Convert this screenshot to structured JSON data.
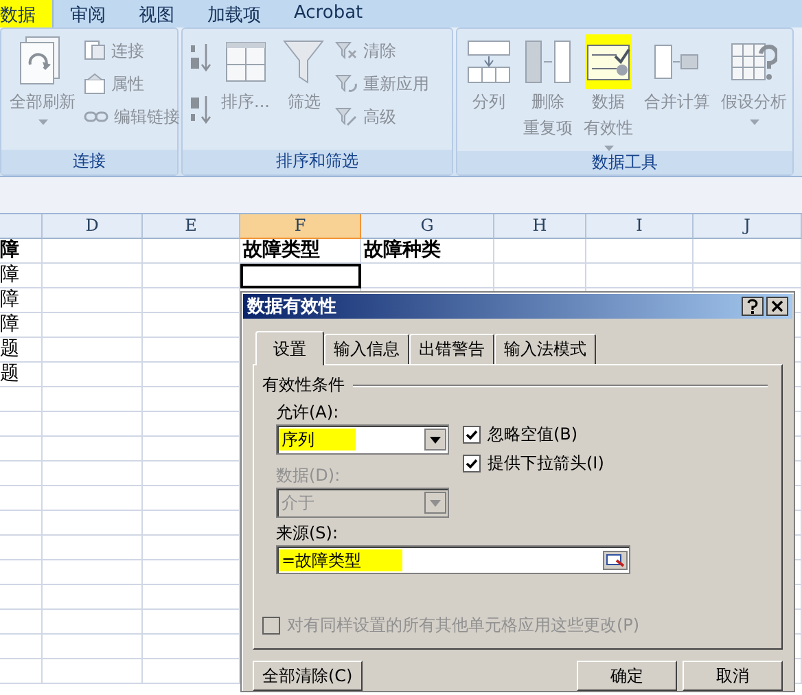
{
  "ribbon_tabs": [
    {
      "label": "数据",
      "selected": true,
      "highlighted": true
    },
    {
      "label": "审阅",
      "selected": false,
      "highlighted": false
    },
    {
      "label": "视图",
      "selected": false,
      "highlighted": false
    },
    {
      "label": "加载项",
      "selected": false,
      "highlighted": false
    },
    {
      "label": "Acrobat",
      "selected": false,
      "highlighted": false
    }
  ],
  "ribbon_groups": [
    {
      "title": "连接",
      "items": [
        {
          "kind": "large",
          "label": "全部刷新",
          "dropdown": true
        },
        {
          "kind": "small",
          "label": "连接"
        },
        {
          "kind": "small",
          "label": "属性"
        },
        {
          "kind": "small",
          "label": "编辑链接"
        }
      ]
    },
    {
      "title": "排序和筛选",
      "items": [
        {
          "kind": "icon"
        },
        {
          "kind": "icon"
        },
        {
          "kind": "large",
          "label": "排序..."
        },
        {
          "kind": "large",
          "label": "筛选"
        },
        {
          "kind": "small",
          "label": "清除"
        },
        {
          "kind": "small",
          "label": "重新应用"
        },
        {
          "kind": "small",
          "label": "高级"
        }
      ]
    },
    {
      "title": "数据工具",
      "items": [
        {
          "kind": "large",
          "label": "分列"
        },
        {
          "kind": "large",
          "label_lines": [
            "删除",
            "重复项"
          ]
        },
        {
          "kind": "large",
          "label_lines": [
            "数据",
            "有效性"
          ],
          "dropdown": true,
          "highlighted": true
        },
        {
          "kind": "large",
          "label": "合并计算"
        },
        {
          "kind": "large",
          "label": "假设分析",
          "dropdown": true
        }
      ]
    }
  ],
  "sheet": {
    "columns": [
      {
        "label": "D",
        "selected": false
      },
      {
        "label": "E",
        "selected": false
      },
      {
        "label": "F",
        "selected": true
      },
      {
        "label": "G",
        "selected": false
      },
      {
        "label": "H",
        "selected": false
      },
      {
        "label": "I",
        "selected": false
      },
      {
        "label": "J",
        "selected": false
      }
    ],
    "rows": [
      {
        "kind": "heading",
        "cells": {
          "cell_1": "障",
          "cell_4": "故障类型",
          "cell_5": "故障种类"
        }
      },
      {
        "kind": "data",
        "cells": {
          "cell_1": "障",
          "cell_4": {
            "active": true
          }
        }
      },
      {
        "kind": "data",
        "cells": {
          "cell_1": "障"
        }
      },
      {
        "kind": "data",
        "cells": {
          "cell_1": "障"
        }
      },
      {
        "kind": "data",
        "cells": {
          "cell_1": "题"
        }
      },
      {
        "kind": "data",
        "cells": {
          "cell_1": "题"
        }
      }
    ]
  },
  "dialog": {
    "title": "数据有效性",
    "tabs": [
      {
        "label": "设置",
        "selected": true
      },
      {
        "label": "输入信息",
        "selected": false
      },
      {
        "label": "出错警告",
        "selected": false
      },
      {
        "label": "输入法模式",
        "selected": false
      }
    ],
    "section_title": "有效性条件",
    "allow": {
      "label": "允许(A):",
      "value": "序列",
      "disabled": false,
      "highlighted": true
    },
    "data": {
      "label": "数据(D):",
      "value": "介于",
      "disabled": true
    },
    "options": [
      {
        "label": "忽略空值(B)",
        "checked": true,
        "disabled": false
      },
      {
        "label": "提供下拉箭头(I)",
        "checked": true,
        "disabled": false
      }
    ],
    "source": {
      "label": "来源(S):",
      "value": "=故障类型",
      "highlighted": true
    },
    "apply_all": {
      "label": "对有同样设置的所有其他单元格应用这些更改(P)",
      "checked": false,
      "disabled": true
    },
    "buttons": [
      {
        "label": "全部清除(C)",
        "kind": "left"
      },
      {
        "label": "确定",
        "kind": "right"
      },
      {
        "label": "取消",
        "kind": "right"
      }
    ]
  }
}
